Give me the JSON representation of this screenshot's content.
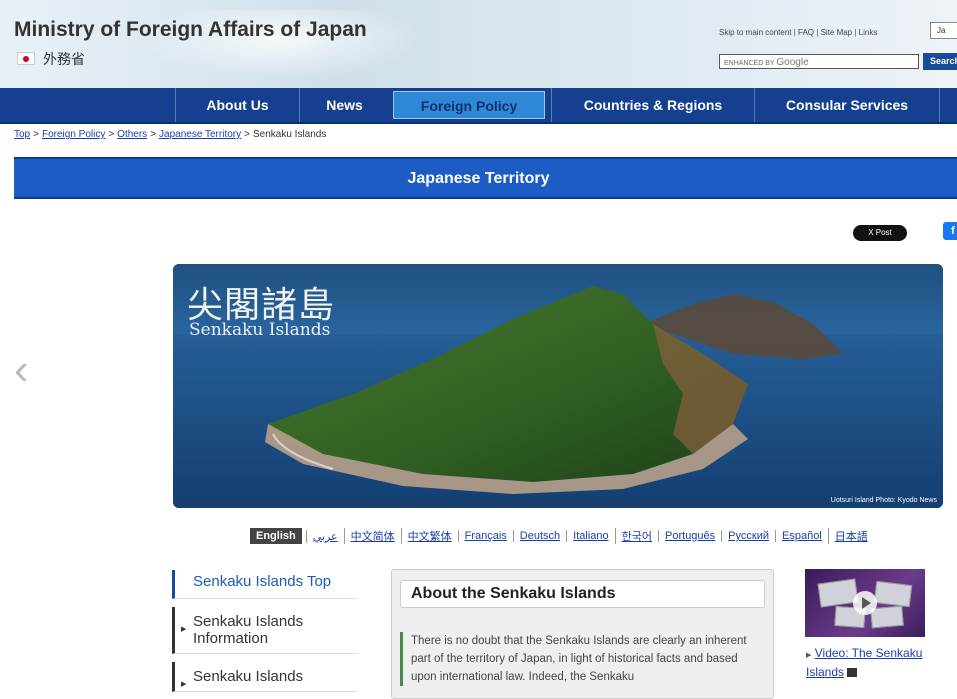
{
  "header": {
    "site_title": "Ministry of Foreign Affairs of Japan",
    "jp_name": "外務省",
    "util_links": [
      "Skip to main content",
      "FAQ",
      "Site Map",
      "Links"
    ],
    "lang_button": "Ja",
    "search_placeholder_prefix": "ENHANCED BY",
    "search_placeholder_brand": "Google",
    "search_button": "Search"
  },
  "nav": {
    "items": [
      {
        "label": "About Us"
      },
      {
        "label": "News"
      },
      {
        "label": "Foreign Policy"
      },
      {
        "label": "Countries & Regions"
      },
      {
        "label": "Consular Services"
      }
    ]
  },
  "breadcrumb": {
    "items": [
      "Top",
      "Foreign Policy",
      "Others",
      "Japanese Territory"
    ],
    "current": "Senkaku Islands"
  },
  "banner": {
    "title": "Japanese Territory"
  },
  "social": {
    "xpost": "X Post",
    "fb": "f"
  },
  "carousel": {
    "prev_arrow": "‹",
    "title_kanji": "尖閣諸島",
    "title_en": "Senkaku Islands",
    "credit": "Uotsuri Island   Photo: Kyodo News"
  },
  "languages": [
    {
      "label": "English"
    },
    {
      "label": "عربي"
    },
    {
      "label": "中文简体"
    },
    {
      "label": "中文繁体"
    },
    {
      "label": "Français"
    },
    {
      "label": "Deutsch"
    },
    {
      "label": "Italiano"
    },
    {
      "label": "한국어"
    },
    {
      "label": "Português"
    },
    {
      "label": "Русский"
    },
    {
      "label": "Español"
    },
    {
      "label": "日本語"
    }
  ],
  "sidebar": {
    "top": "Senkaku Islands Top",
    "items": [
      {
        "label": "Senkaku Islands Information"
      },
      {
        "label": "Senkaku Islands"
      }
    ]
  },
  "main": {
    "heading": "About the Senkaku Islands",
    "body": "There is no doubt that the Senkaku Islands are clearly an inherent part of the territory of Japan, in light of historical facts and based upon international law. Indeed, the Senkaku"
  },
  "video": {
    "link": "Video: The Senkaku Islands"
  },
  "colors": {
    "nav_bg": "#14408f",
    "nav_active": "#2f88d6",
    "banner_bg": "#1c5cc4",
    "link": "#1a3ea8"
  }
}
